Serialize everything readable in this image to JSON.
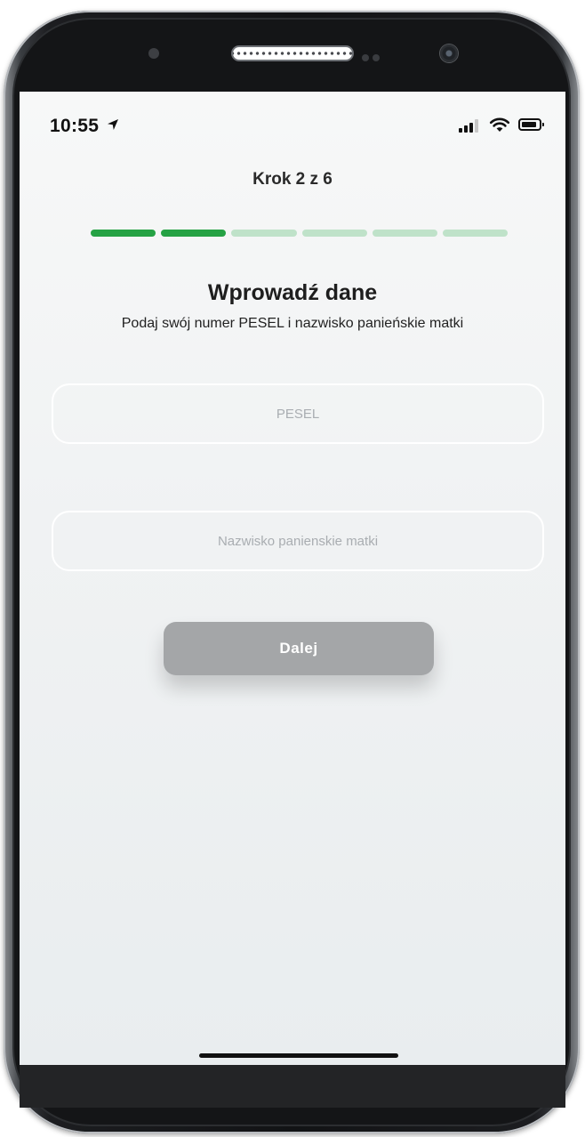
{
  "status_bar": {
    "time": "10:55",
    "icons": [
      "location-arrow-icon",
      "cellular-signal-icon",
      "wifi-icon",
      "battery-icon"
    ]
  },
  "step": {
    "label": "Krok 2 z 6",
    "current": 2,
    "total": 6
  },
  "colors": {
    "progress_done": "#25a244",
    "progress_todo": "#bfe2c9",
    "button_disabled": "#a4a6a8"
  },
  "form": {
    "title": "Wprowadź dane",
    "subtitle": "Podaj swój numer PESEL i nazwisko panieńskie matki",
    "pesel": {
      "placeholder": "PESEL",
      "value": ""
    },
    "maiden_name": {
      "placeholder": "Nazwisko panienskie matki",
      "value": ""
    },
    "next_button_label": "Dalej"
  }
}
